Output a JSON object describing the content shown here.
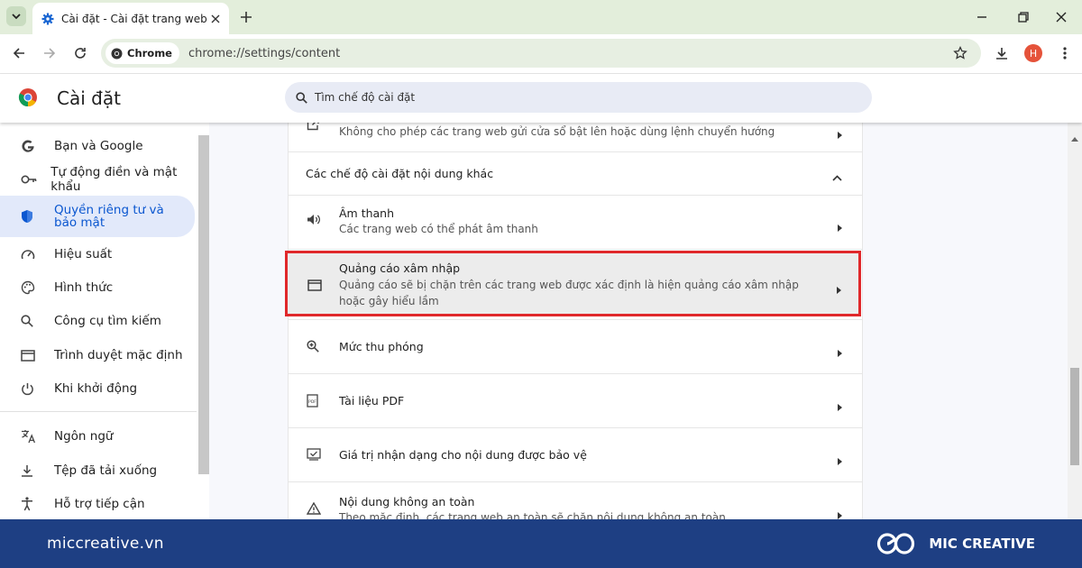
{
  "browser": {
    "tab_title": "Cài đặt - Cài đặt trang web",
    "chip_label": "Chrome",
    "url": "chrome://settings/content",
    "profile_initial": "H"
  },
  "settings": {
    "title": "Cài đặt",
    "search_placeholder": "Tìm chế độ cài đặt"
  },
  "sidebar": {
    "items": [
      {
        "label": "Bạn và Google",
        "icon": "google-g-icon"
      },
      {
        "label": "Tự động điền và mật khẩu",
        "icon": "key-icon"
      },
      {
        "label": "Quyền riêng tư và bảo mật",
        "icon": "shield-icon",
        "active": true
      },
      {
        "label": "Hiệu suất",
        "icon": "speedometer-icon"
      },
      {
        "label": "Hình thức",
        "icon": "palette-icon"
      },
      {
        "label": "Công cụ tìm kiếm",
        "icon": "search-icon"
      },
      {
        "label": "Trình duyệt mặc định",
        "icon": "browser-window-icon"
      },
      {
        "label": "Khi khởi động",
        "icon": "power-icon"
      },
      {
        "label": "Ngôn ngữ",
        "icon": "translate-icon"
      },
      {
        "label": "Tệp đã tải xuống",
        "icon": "download-icon"
      },
      {
        "label": "Hỗ trợ tiếp cận",
        "icon": "accessibility-icon"
      }
    ]
  },
  "content": {
    "popup_sub": "Không cho phép các trang web gửi cửa sổ bật lên hoặc dùng lệnh chuyển hướng",
    "section_header": "Các chế độ cài đặt nội dung khác",
    "rows": [
      {
        "title": "Âm thanh",
        "sub": "Các trang web có thể phát âm thanh",
        "icon": "speaker-icon"
      },
      {
        "title": "Quảng cáo xâm nhập",
        "sub": "Quảng cáo sẽ bị chặn trên các trang web được xác định là hiện quảng cáo xâm nhập hoặc gây hiểu lầm",
        "icon": "ad-window-icon",
        "highlighted": true
      },
      {
        "title": "Mức thu phóng",
        "icon": "zoom-icon"
      },
      {
        "title": "Tài liệu PDF",
        "icon": "pdf-icon"
      },
      {
        "title": "Giá trị nhận dạng cho nội dung được bảo vệ",
        "icon": "protected-content-icon"
      },
      {
        "title": "Nội dung không an toàn",
        "sub": "Theo mặc định, các trang web an toàn sẽ chặn nội dung không an toàn",
        "icon": "warning-icon"
      }
    ]
  },
  "footer": {
    "site": "miccreative.vn",
    "brand": "MIC CREATIVE"
  },
  "colors": {
    "accent": "#0b57d0",
    "highlight_border": "#e0282b",
    "footer_bg": "#1e3f83"
  }
}
